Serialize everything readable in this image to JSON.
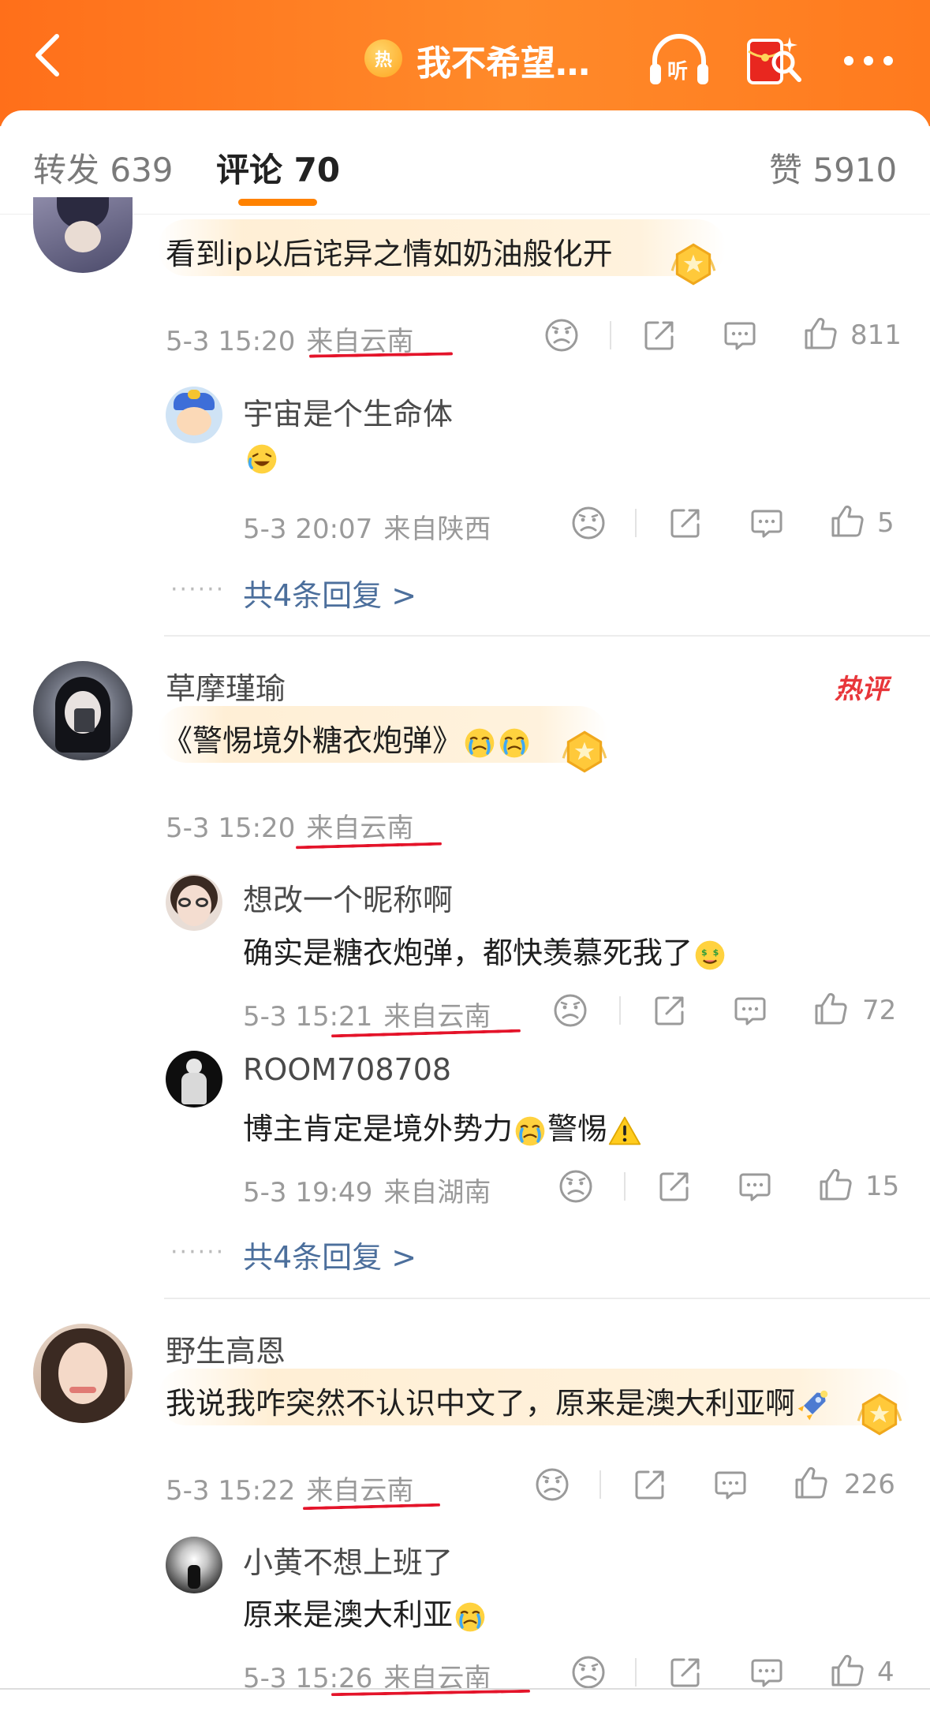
{
  "header": {
    "hot_badge": "热",
    "title": "我不希望…",
    "listen_label": "听"
  },
  "tabs": {
    "repost": "转发 639",
    "comments": "评论 70",
    "likes": "赞 5910"
  },
  "comments": [
    {
      "text": "看到ip以后诧异之情如奶油般化开",
      "time": "5-3 15:20",
      "loc": "来自云南",
      "likes": "811",
      "replies": [
        {
          "name": "宇宙是个生命体",
          "time": "5-3 20:07",
          "loc": "来自陕西",
          "likes": "5"
        }
      ],
      "more": "共4条回复 >"
    },
    {
      "name": "草摩瑾瑜",
      "hot_tag": "热评",
      "text": "《警惕境外糖衣炮弹》",
      "time": "5-3 15:20",
      "loc": "来自云南",
      "replies": [
        {
          "name": "想改一个昵称啊",
          "text": "确实是糖衣炮弹，都快羡慕死我了",
          "time": "5-3 15:21",
          "loc": "来自云南",
          "likes": "72"
        },
        {
          "name": "ROOM708708",
          "text_a": "博主肯定是境外势力",
          "text_b": "警惕",
          "time": "5-3 19:49",
          "loc": "来自湖南",
          "likes": "15"
        }
      ],
      "more": "共4条回复 >"
    },
    {
      "name": "野生高恩",
      "text": "我说我咋突然不认识中文了，原来是澳大利亚啊",
      "time": "5-3 15:22",
      "loc": "来自云南",
      "likes": "226",
      "replies": [
        {
          "name": "小黄不想上班了",
          "text": "原来是澳大利亚",
          "time": "5-3 15:26",
          "loc": "来自云南",
          "likes": "4"
        }
      ]
    }
  ],
  "colors": {
    "accent": "#ff8200",
    "link": "#4c6f9c",
    "annotation": "#e4142a"
  },
  "icons": [
    "back-arrow-icon",
    "headphones-icon",
    "red-envelope-icon",
    "more-icon",
    "sad-face-icon",
    "share-icon",
    "comment-icon",
    "thumbs-up-icon",
    "gold-medal-icon"
  ]
}
